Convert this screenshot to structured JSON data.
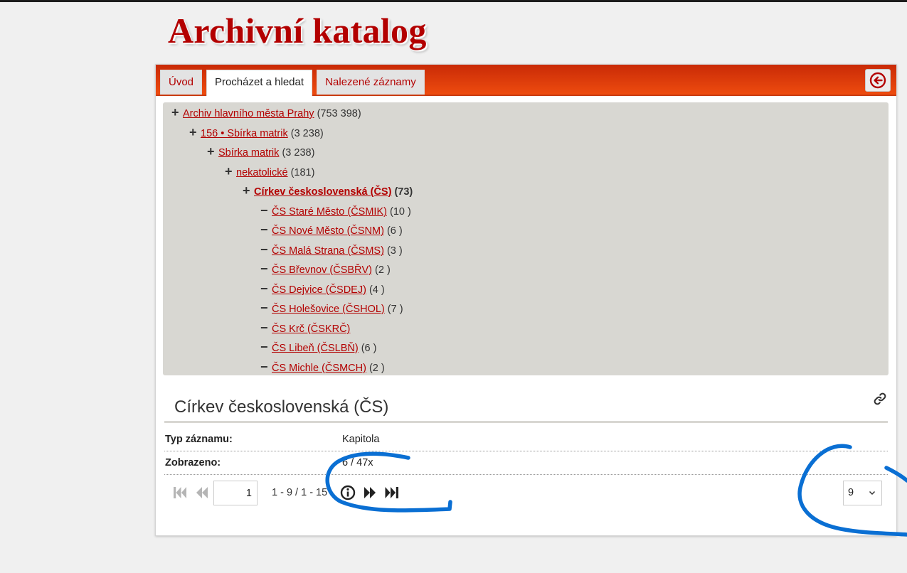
{
  "app": {
    "title": "Archivní katalog"
  },
  "tabs": [
    {
      "label": "Úvod"
    },
    {
      "label": "Procházet a hledat"
    },
    {
      "label": "Nalezené záznamy"
    }
  ],
  "active_tab": "Procházet a hledat",
  "tree": [
    {
      "symbol": "+",
      "label": "Archiv hlavního města Prahy",
      "count": "(753 398)"
    },
    {
      "symbol": "+",
      "label": "156 • Sbírka matrik",
      "count": "(3 238)"
    },
    {
      "symbol": "+",
      "label": "Sbírka matrik",
      "count": "(3 238)"
    },
    {
      "symbol": "+",
      "label": "nekatolické",
      "count": "(181)"
    },
    {
      "symbol": "+",
      "label": "Církev československá (ČS)",
      "count": "(73)",
      "current": true
    },
    {
      "symbol": "−",
      "label": "ČS Staré Město (ČSMIK)",
      "count": "(10 )"
    },
    {
      "symbol": "−",
      "label": "ČS Nové Město (ČSNM)",
      "count": "(6 )"
    },
    {
      "symbol": "−",
      "label": "ČS Malá Strana (ČSMS)",
      "count": "(3 )"
    },
    {
      "symbol": "−",
      "label": "ČS Břevnov (ČSBŘV)",
      "count": "(2 )"
    },
    {
      "symbol": "−",
      "label": "ČS Dejvice (ČSDEJ)",
      "count": "(4 )"
    },
    {
      "symbol": "−",
      "label": "ČS Holešovice (ČSHOL)",
      "count": "(7 )"
    },
    {
      "symbol": "−",
      "label": "ČS Krč (ČSKRČ)",
      "count": ""
    },
    {
      "symbol": "−",
      "label": "ČS Libeň (ČSLBŇ)",
      "count": "(6 )"
    },
    {
      "symbol": "−",
      "label": "ČS Michle (ČSMCH)",
      "count": "(2 )"
    }
  ],
  "detail": {
    "title": "Církev československá (ČS)",
    "fields": [
      {
        "label": "Typ záznamu:",
        "value": "Kapitola"
      },
      {
        "label": "Zobrazeno:",
        "value": "6 / 47x"
      }
    ]
  },
  "pager": {
    "page": "1",
    "range_text": "1 - 9  /  1 - 15",
    "per_page": "9"
  },
  "icons": {
    "back": "arrow-left-circle-icon",
    "link": "link-icon",
    "first": "skip-first-icon",
    "prev": "rewind-icon",
    "info": "info-icon",
    "next": "fast-forward-icon",
    "last": "skip-last-icon",
    "dropdown": "chevron-down-icon"
  },
  "colors": {
    "title_red": "#b30000",
    "tabbar_orange": "#e1400c",
    "tree_bg": "#d8d7d2",
    "annotation_blue": "#0a6fd3"
  }
}
